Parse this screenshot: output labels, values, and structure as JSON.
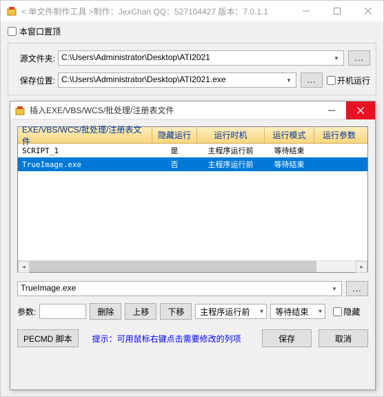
{
  "mainWindow": {
    "title": "< 单文件制作工具 >制作：JexChan   QQ：527104427   版本：7.0.1.1",
    "pinCheckbox": "本窗口置顶",
    "sourceLabel": "源文件夹:",
    "sourcePath": "C:\\Users\\Administrator\\Desktop\\ATI2021",
    "saveLabel": "保存位置:",
    "savePath": "C:\\Users\\Administrator\\Desktop\\ATI2021.exe",
    "runOnBoot": "开机运行",
    "browse": "..."
  },
  "dialog": {
    "title": "插入EXE/VBS/WCS/批处理/注册表文件",
    "columns": [
      "EXE/VBS/WCS/批处理/注册表文件",
      "隐藏运行",
      "运行时机",
      "运行模式",
      "运行参数"
    ],
    "rows": [
      {
        "file": "SCRIPT_1",
        "hidden": "是",
        "timing": "主程序运行前",
        "mode": "等待结束",
        "params": ""
      },
      {
        "file": "TrueImage.exe",
        "hidden": "否",
        "timing": "主程序运行前",
        "mode": "等待结束",
        "params": ""
      }
    ],
    "selectedRow": 1,
    "filenameValue": "TrueImage.exe",
    "browse": "...",
    "paramLabel": "参数:",
    "paramValue": "",
    "deleteBtn": "删除",
    "upBtn": "上移",
    "downBtn": "下移",
    "timingSelect": "主程序运行前",
    "modeSelect": "等待结束",
    "hiddenCheck": "隐藏",
    "pecmdBtn": "PECMD 脚本",
    "hint": "提示：可用鼠标右键点击需要修改的列项",
    "saveBtn": "保存",
    "cancelBtn": "取消"
  }
}
